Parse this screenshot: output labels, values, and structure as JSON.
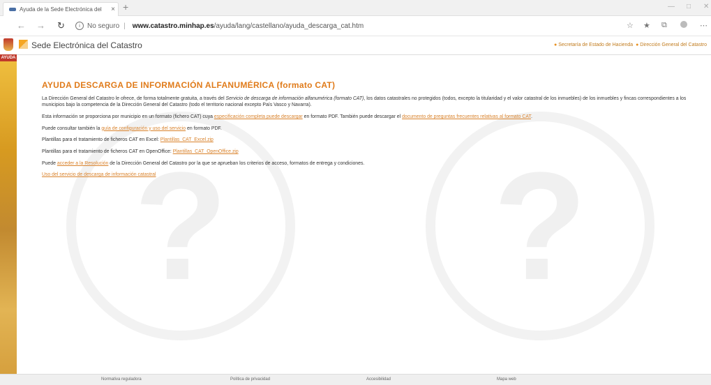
{
  "browser": {
    "tab_title": "Ayuda de la Sede Electrónica del",
    "tab_close": "×",
    "new_tab": "+",
    "url_secure_label": "No seguro",
    "url_separator": "|",
    "url_host": "www.catastro.minhap.es",
    "url_path": "/ayuda/lang/castellano/ayuda_descarga_cat.htm"
  },
  "site": {
    "title": "Sede Electrónica del Catastro",
    "sidebar_label": "AYUDA",
    "header_link_1": "Secretaría de Estado de Hacienda",
    "header_link_2": "Dirección General del Catastro"
  },
  "page": {
    "heading": "AYUDA DESCARGA DE INFORMACIÓN ALFANUMÉRICA (formato CAT)",
    "p1_a": "La Dirección General del Catastro le ofrece, de forma totalmente gratuita, a través del ",
    "p1_italic": "Servicio de descarga de información alfanumérica (formato CAT)",
    "p1_b": ", los datos catastrales no protegidos (todos, excepto la titularidad y el valor catastral de los inmuebles) de los inmuebles y fincas  correspondientes a los municipios bajo la competencia de la Dirección General del Catastro (todo el territorio nacional excepto País Vasco y Navarra).",
    "p2_a": "Esta información se proporciona por municipio en un formato (fichero CAT) cuya ",
    "p2_link1": "especificación completa puede descargar",
    "p2_b": " en formato PDF. También puede descargar el ",
    "p2_link2": "documento de preguntas frecuentes relativas al formato CAT",
    "p2_c": ".",
    "p3_a": "Puede consultar también la ",
    "p3_link": "guía de configuración y uso del servicio",
    "p3_b": " en formato PDF.",
    "p4_a": "Plantillas para el tratamiento de ficheros CAT en Excel: ",
    "p4_link": "Plantillas_CAT_Excel.zip",
    "p5_a": "Plantillas para el tratamiento de ficheros CAT en OpenOffice: ",
    "p5_link": "Plantillas_CAT_OpenOffice.zip",
    "p6_a": "Puede ",
    "p6_link": "acceder a la Resolución",
    "p6_b": " de la Dirección General del Catastro por la que se aprueban los criterios de acceso, formatos de entrega y condiciones.",
    "p7_link": "Uso del servicio de descarga de información catastral"
  },
  "footer": {
    "link1": "Normativa reguladora",
    "link2": "Política de privacidad",
    "link3": "Accesibilidad",
    "link4": "Mapa web"
  }
}
